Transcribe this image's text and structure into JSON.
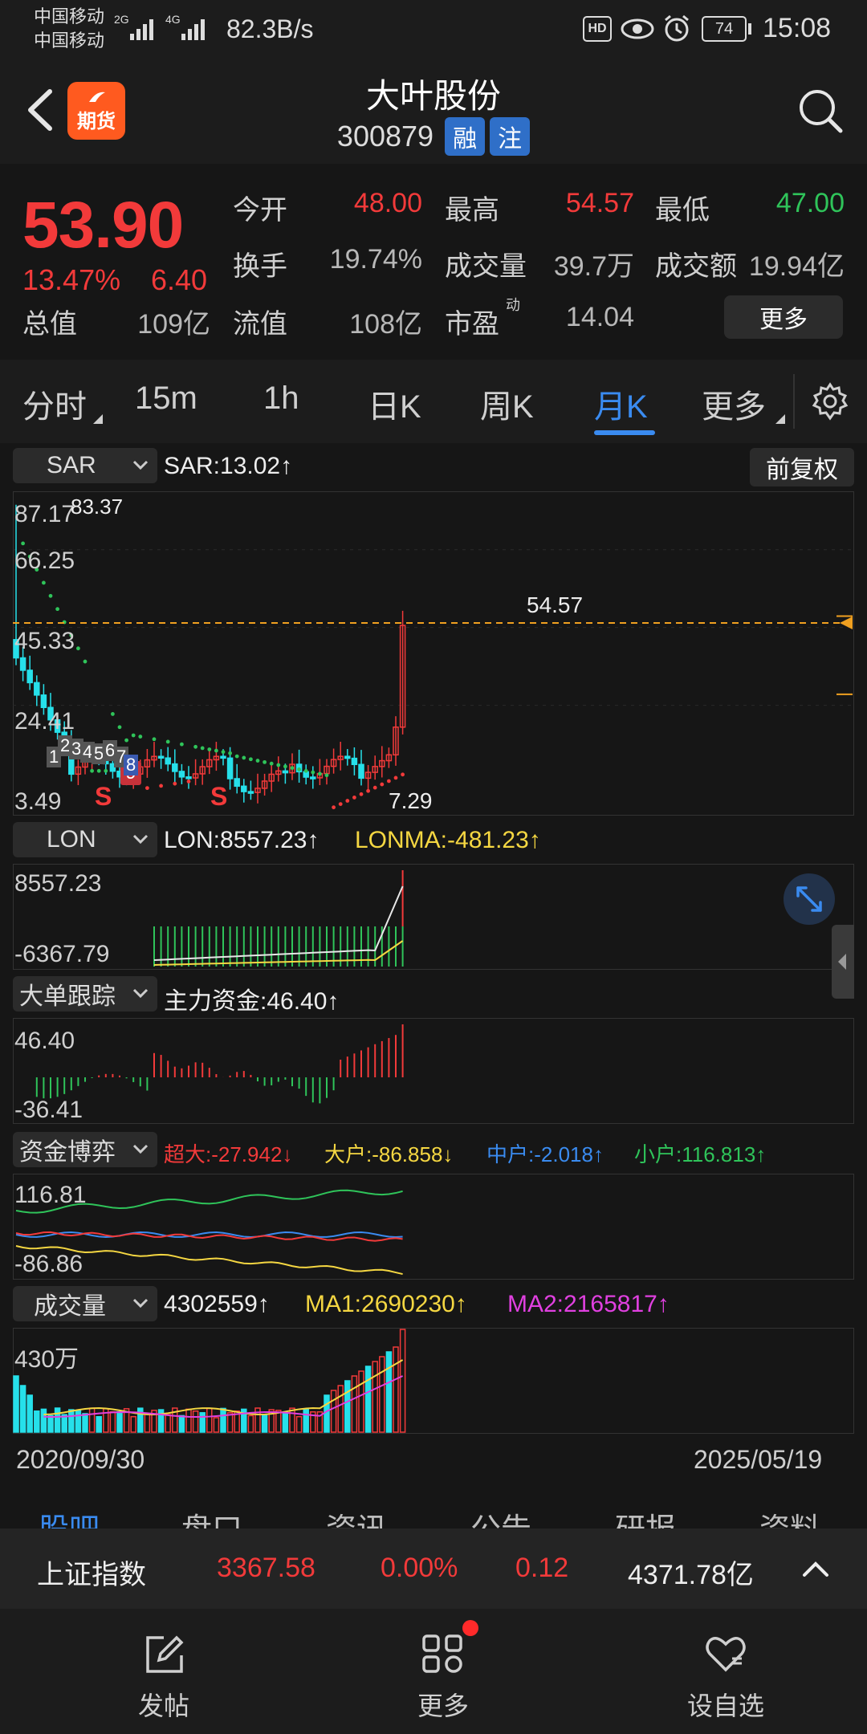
{
  "status_bar": {
    "carrier1": "中国移动",
    "carrier2": "中国移动",
    "net1": "2G",
    "net2": "4G",
    "speed": "82.3B/s",
    "hd": "HD",
    "battery": "74",
    "time": "15:08"
  },
  "header": {
    "futures_badge": "期货",
    "stock_name": "大叶股份",
    "stock_code": "300879",
    "tag1": "融",
    "tag2": "注"
  },
  "quote": {
    "price": "53.90",
    "change_pct": "13.47%",
    "change_amt": "6.40",
    "rows": [
      [
        {
          "label": "今开",
          "value": "48.00",
          "color": "red"
        },
        {
          "label": "最高",
          "value": "54.57",
          "color": "red"
        },
        {
          "label": "最低",
          "value": "47.00",
          "color": "green"
        }
      ],
      [
        {
          "label": "换手",
          "value": "19.74%",
          "color": "gray"
        },
        {
          "label": "成交量",
          "value": "39.7万",
          "color": "gray"
        },
        {
          "label": "成交额",
          "value": "19.94亿",
          "color": "gray"
        }
      ]
    ],
    "total_value_label": "总值",
    "total_value": "109亿",
    "float_value_label": "流值",
    "float_value": "108亿",
    "pe_label": "市盈",
    "pe_sup": "动",
    "pe_value": "14.04",
    "more_label": "更多"
  },
  "period_tabs": [
    "分时",
    "15m",
    "1h",
    "日K",
    "周K",
    "月K",
    "更多"
  ],
  "active_tab": "月K",
  "main_chart": {
    "indicator": "SAR",
    "readout": "SAR:13.02↑",
    "adjust_label": "前复权",
    "y_labels": [
      "87.17",
      "66.25",
      "45.33",
      "24.41",
      "3.49"
    ],
    "max_label": "83.37",
    "high_label": "54.57",
    "low_label": "7.29",
    "markers": [
      "S",
      "S"
    ],
    "badge_num": "9",
    "event_digits": [
      "1",
      "2",
      "3",
      "4",
      "5",
      "6",
      "7",
      "8"
    ]
  },
  "lon_panel": {
    "indicator": "LON",
    "lon": "LON:8557.23↑",
    "lonma": "LONMA:-481.23↑",
    "y_top": "8557.23",
    "y_bottom": "-6367.79"
  },
  "bigorder_panel": {
    "indicator": "大单跟踪",
    "readout": "主力资金:46.40↑",
    "y_top": "46.40",
    "y_bottom": "-36.41"
  },
  "fund_panel": {
    "indicator": "资金博弈",
    "chaoda": "超大:-27.942↓",
    "dahu": "大户:-86.858↓",
    "zhonghu": "中户:-2.018↑",
    "xiaohu": "小户:116.813↑",
    "y_top": "116.81",
    "y_bottom": "-86.86"
  },
  "volume_panel": {
    "indicator": "成交量",
    "vol": "4302559↑",
    "ma1": "MA1:2690230↑",
    "ma2": "MA2:2165817↑",
    "y_top": "430万"
  },
  "date_start": "2020/09/30",
  "date_end": "2025/05/19",
  "section_tabs": [
    "股吧",
    "盘口",
    "资讯",
    "公告",
    "研报",
    "资料"
  ],
  "index_bar": {
    "name": "上证指数",
    "value": "3367.58",
    "pct": "0.00%",
    "chg": "0.12",
    "amount": "4371.78亿"
  },
  "bottom_nav": {
    "post": "发帖",
    "more": "更多",
    "watchlist": "设自选"
  },
  "colors": {
    "up": "#f23a3a",
    "down": "#2fc45a",
    "accent": "#3a8bf0",
    "lonma": "#f5d742",
    "ma2": "#e040e0"
  }
}
